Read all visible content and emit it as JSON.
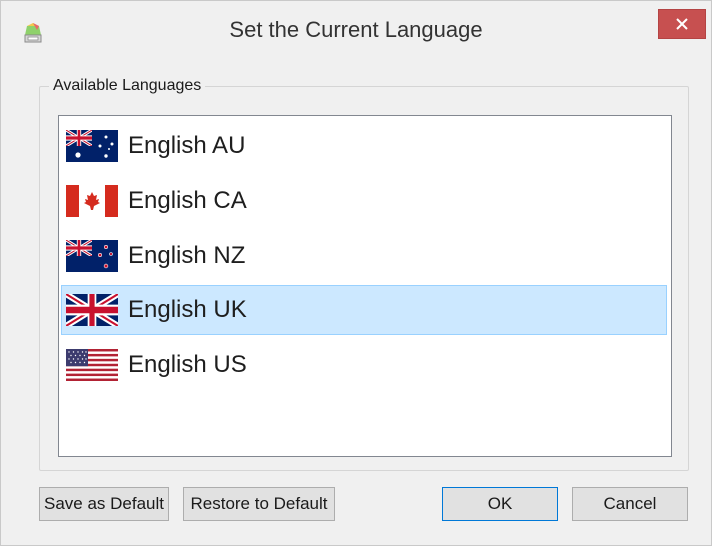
{
  "window": {
    "title": "Set the Current Language"
  },
  "group": {
    "label": "Available Languages"
  },
  "languages": [
    {
      "label": "English AU",
      "flag": "australia-flag-icon",
      "selected": false
    },
    {
      "label": "English CA",
      "flag": "canada-flag-icon",
      "selected": false
    },
    {
      "label": "English NZ",
      "flag": "new-zealand-flag-icon",
      "selected": false
    },
    {
      "label": "English UK",
      "flag": "uk-flag-icon",
      "selected": true
    },
    {
      "label": "English US",
      "flag": "us-flag-icon",
      "selected": false
    }
  ],
  "buttons": {
    "save_default": "Save as Default",
    "restore_default": "Restore to Default",
    "ok": "OK",
    "cancel": "Cancel"
  },
  "colors": {
    "selection_bg": "#cce8ff",
    "selection_border": "#99d1ff",
    "close_button": "#c75050",
    "default_button_border": "#0078d7"
  }
}
